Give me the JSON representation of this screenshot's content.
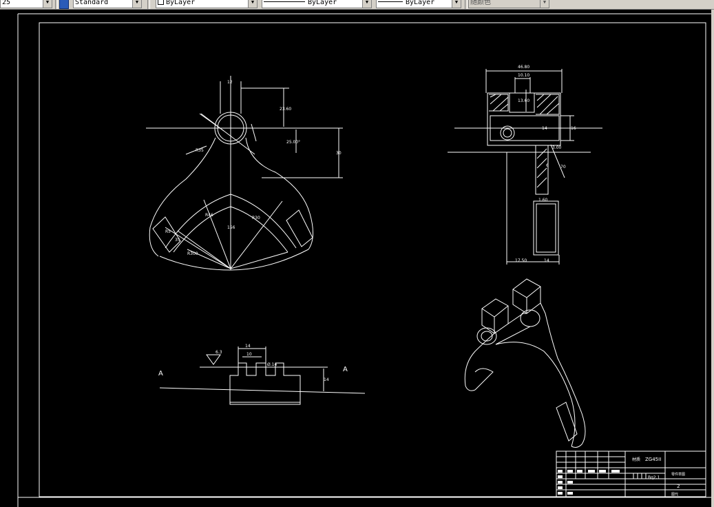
{
  "toolbar": {
    "scale_value": "25",
    "text_style": "Standard",
    "layer_color": "ByLayer",
    "linetype": "ByLayer",
    "lineweight": "ByLayer",
    "plot_style": "随颜色"
  },
  "drawing": {
    "top_view": {
      "dim_width_top": "12",
      "dim_height_upper": "23.60",
      "dim_angle": "25.00°",
      "dim_radius_r35": "R35",
      "dim_height_right": "30",
      "dim_r46": "R46",
      "dim_r30": "R30",
      "dim_156": "156",
      "dim_r": "R5",
      "dim_r300": "R300",
      "dim_small": "35"
    },
    "side_view": {
      "dim_overall": "46.80",
      "dim_slot_width": "10.10",
      "dim_slot_depth": "13.60",
      "dim_bore": "14",
      "dim_right_height": "16",
      "dim_shaft": "3.00",
      "dim_70": "70",
      "dim_small_6": "6",
      "dim_1_60": "1.60",
      "dim_bottom_left": "17.50",
      "dim_bottom_right": "14"
    },
    "section_view": {
      "label_left": "A",
      "label_right": "A",
      "roughness": "6.3",
      "dim_width": "14",
      "dim_inner": "10",
      "dim_phi": "Ø.14",
      "dim_height": "14"
    },
    "title_block": {
      "material_label": "材质",
      "material_value": "ZG45II",
      "drawing_name": "零件草图",
      "scale": "Bq2.1",
      "sheet_count": "2",
      "designation": "图代"
    }
  }
}
